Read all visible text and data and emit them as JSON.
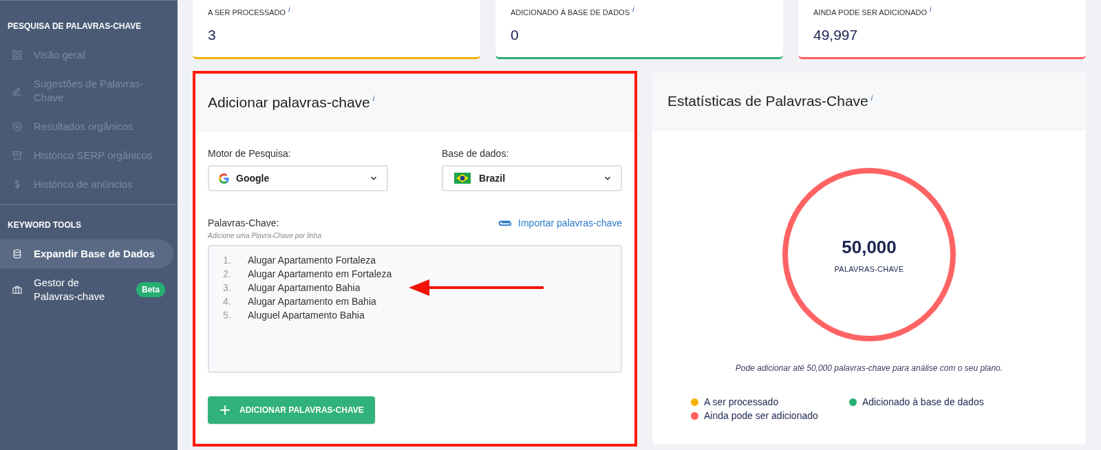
{
  "sidebar": {
    "sections": [
      {
        "title": "PESQUISA DE PALAVRAS-CHAVE",
        "items": [
          {
            "label": "Visão geral",
            "disabled": true,
            "selected": false
          },
          {
            "label": "Sugestões de Palavras-Chave",
            "disabled": true,
            "selected": false
          },
          {
            "label": "Resultados orgânicos",
            "disabled": true,
            "selected": false
          },
          {
            "label": "Histórico SERP orgânicos",
            "disabled": true,
            "selected": false
          },
          {
            "label": "Histórico de anúncios",
            "disabled": true,
            "selected": false
          }
        ]
      },
      {
        "title": "KEYWORD TOOLS",
        "items": [
          {
            "label": "Expandir Base de Dados",
            "disabled": false,
            "selected": true
          },
          {
            "label": "Gestor de Palavras-chave",
            "disabled": false,
            "selected": false,
            "badge": "Beta"
          }
        ]
      }
    ]
  },
  "stat_cards": [
    {
      "label": "A SER PROCESSADO",
      "info": "i",
      "value": "3",
      "color": "#f5b400"
    },
    {
      "label": "ADICIONADO À BASE DE DADOS",
      "info": "i",
      "value": "0",
      "color": "#27ae72"
    },
    {
      "label": "AINDA PODE SER ADICIONADO",
      "info": "i",
      "value": "49,997",
      "color": "#ff5f5f"
    }
  ],
  "add_panel": {
    "highlighted": true,
    "title": "Adicionar palavras-chave",
    "info": "i",
    "engine": {
      "label": "Motor de Pesquisa:",
      "value": "Google"
    },
    "database": {
      "label": "Base de dados:",
      "value": "Brazil"
    },
    "keywords_label": "Palavras-Chave:",
    "keywords_hint": "Adicione uma Plavra-Chave por linha",
    "import_link": "Importar palavras-chave",
    "keywords": [
      {
        "number": "1.",
        "text": "Alugar Apartamento Fortaleza",
        "pointed": false
      },
      {
        "number": "2.",
        "text": "Alugar Apartamento em Fortaleza",
        "pointed": false
      },
      {
        "number": "3.",
        "text": "Alugar Apartamento Bahia",
        "pointed": true
      },
      {
        "number": "4.",
        "text": "Alugar Apartamento em Bahia",
        "pointed": false
      },
      {
        "number": "5.",
        "text": "Aluguel Apartamento Bahia",
        "pointed": false
      }
    ],
    "button": "ADICIONAR PALAVRAS-CHAVE"
  },
  "stats_panel": {
    "title": "Estatísticas de Palavras-Chave",
    "info": "i",
    "total": "50,000",
    "total_label": "PALAVRAS-CHAVE",
    "note": "Pode adicionar até 50,000 palavras-chave para análise com o seu plano.",
    "legend": [
      {
        "label": "A ser processado",
        "color": "#f5b400"
      },
      {
        "label": "Adicionado à base de dados",
        "color": "#27ae72"
      },
      {
        "label": "Ainda pode ser adicionado",
        "color": "#ff5f5f"
      }
    ]
  }
}
